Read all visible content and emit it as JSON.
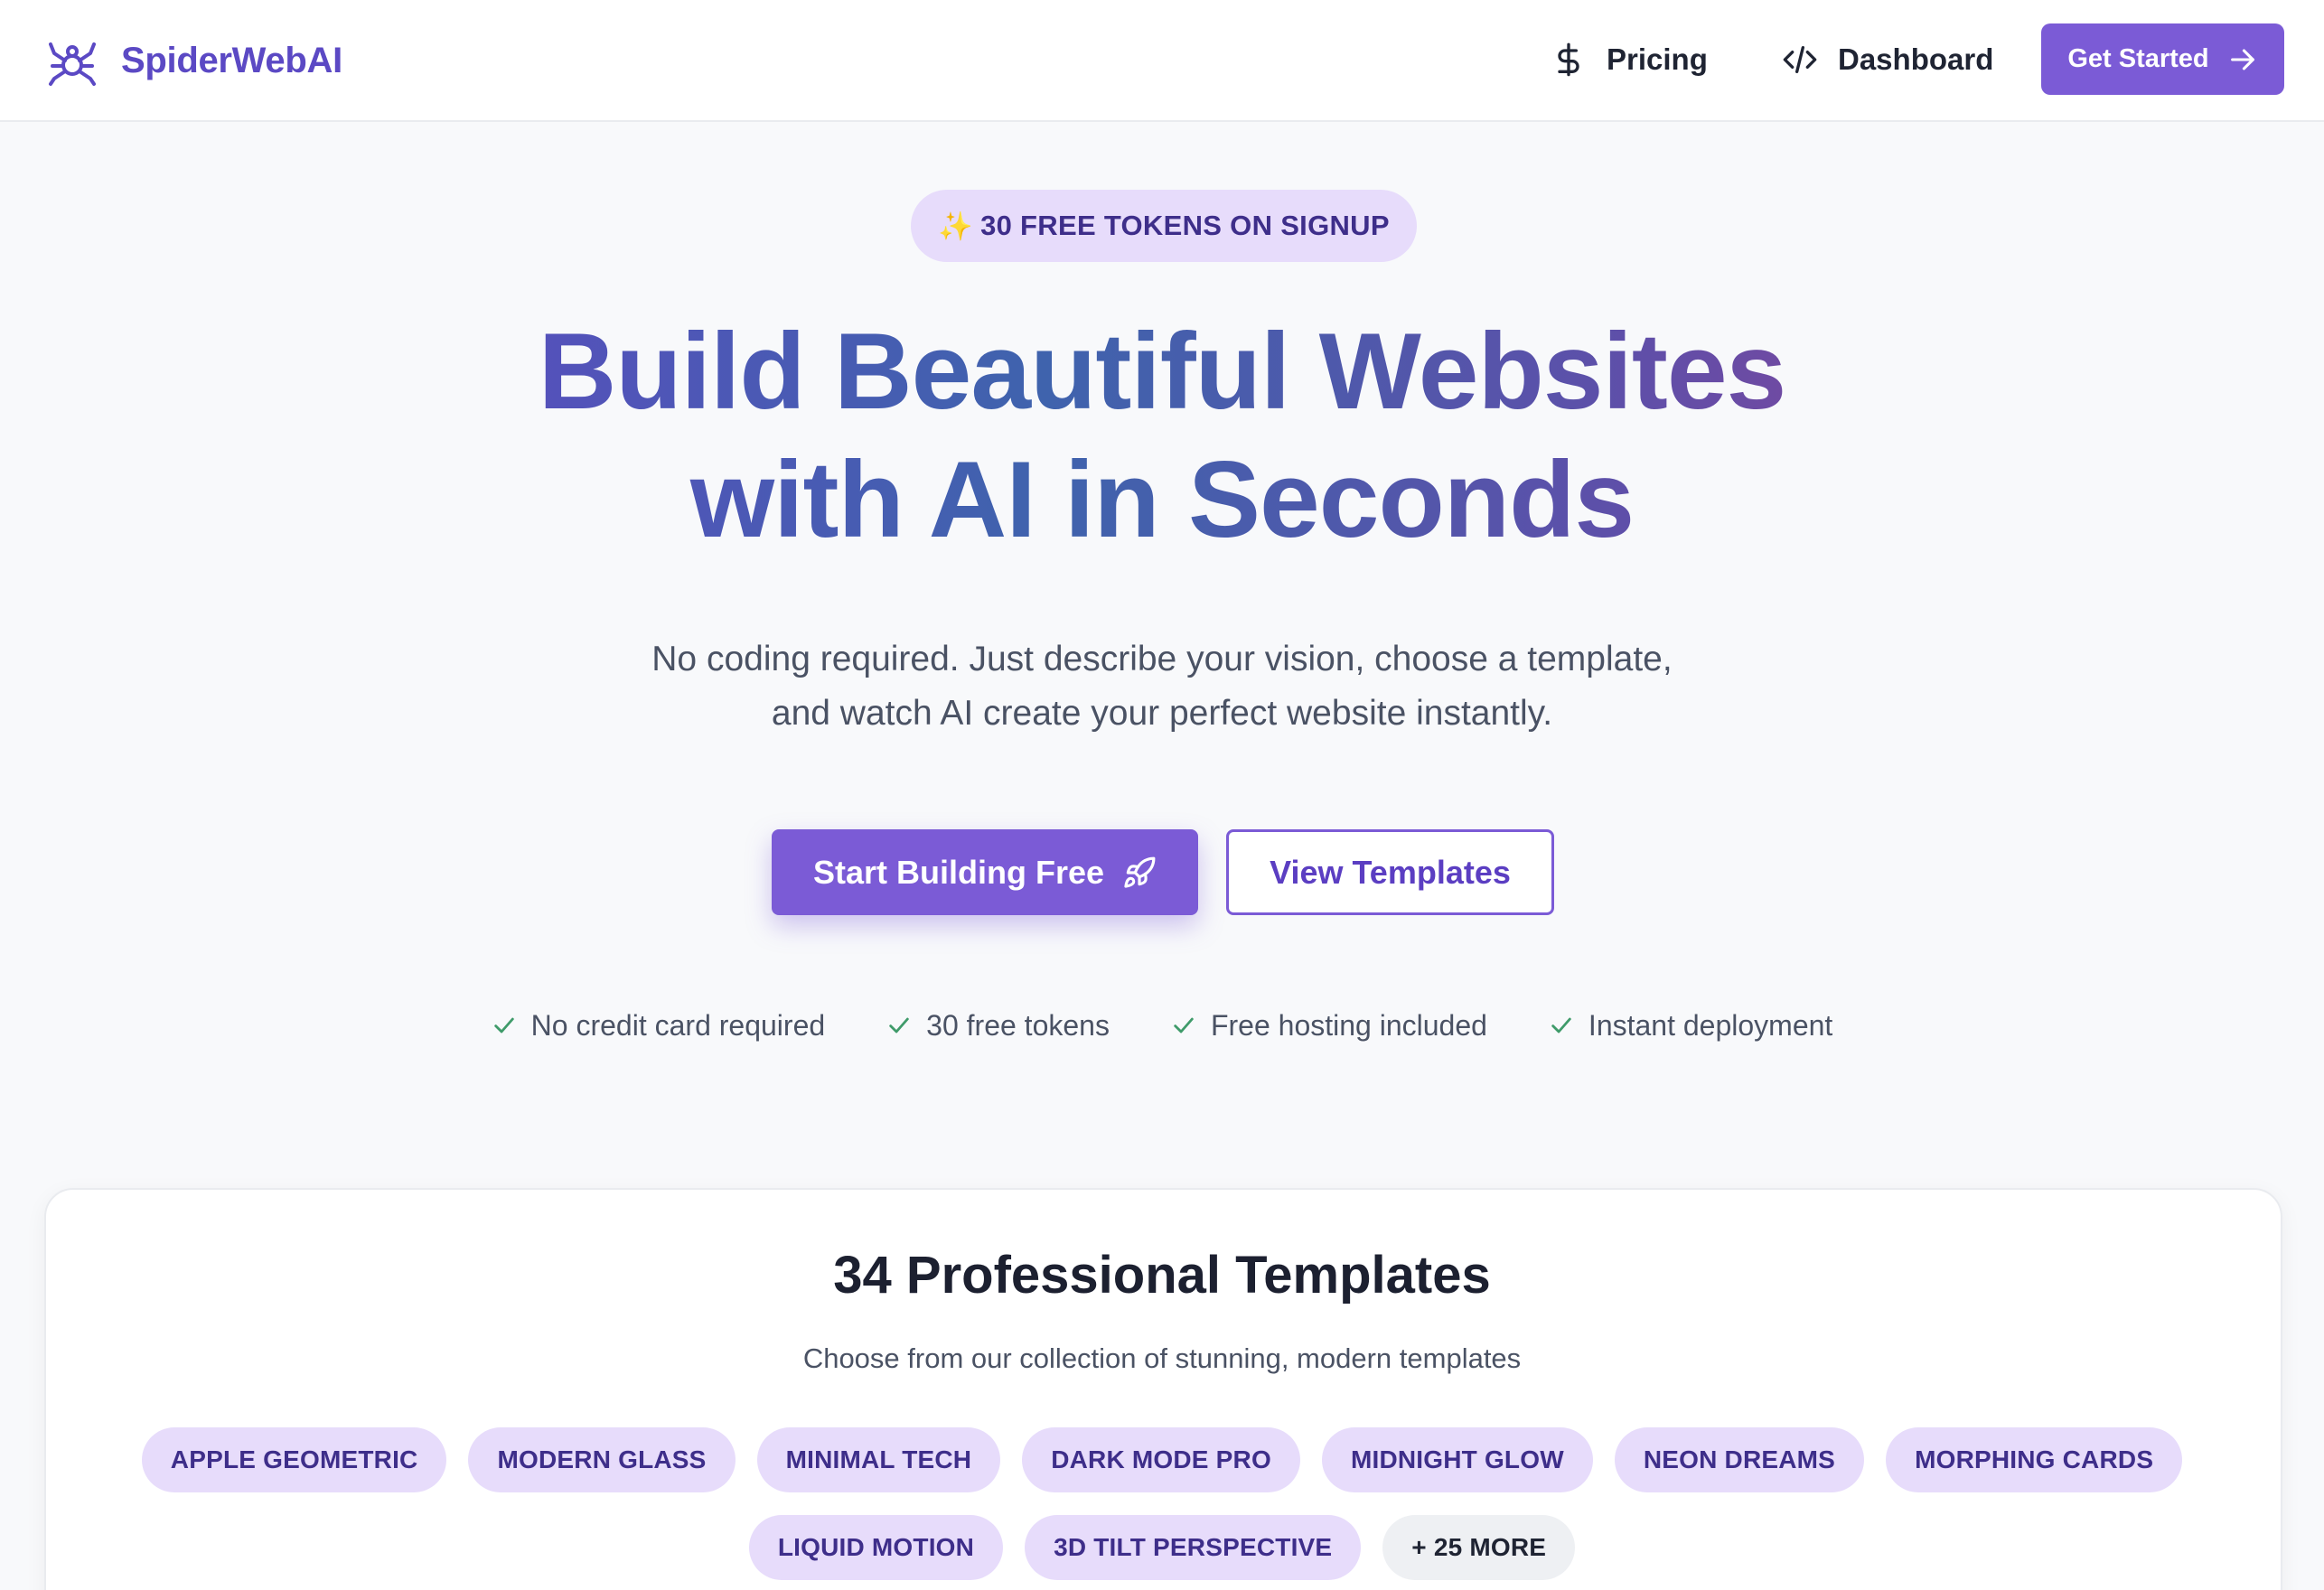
{
  "header": {
    "brand_name": "SpiderWebAI",
    "nav": [
      {
        "label": "Pricing",
        "icon": "dollar-icon"
      },
      {
        "label": "Dashboard",
        "icon": "code-icon"
      }
    ],
    "cta_label": "Get Started"
  },
  "hero": {
    "badge_icon": "✨",
    "badge": "30 FREE TOKENS ON SIGNUP",
    "title_line1": "Build Beautiful Websites",
    "title_line2": "with AI in Seconds",
    "subtitle_line1": "No coding required. Just describe your vision, choose a template,",
    "subtitle_line2": "and watch AI create your perfect website instantly.",
    "primary_button": "Start Building Free",
    "secondary_button": "View Templates",
    "features": [
      "No credit card required",
      "30 free tokens",
      "Free hosting included",
      "Instant deployment"
    ]
  },
  "templates": {
    "title": "34 Professional Templates",
    "subtitle": "Choose from our collection of stunning, modern templates",
    "tags_row1": [
      "APPLE GEOMETRIC",
      "MODERN GLASS",
      "MINIMAL TECH",
      "DARK MODE PRO",
      "MIDNIGHT GLOW",
      "NEON DREAMS",
      "MORPHING CARDS"
    ],
    "tags_row2": [
      "LIQUID MOTION",
      "3D TILT PERSPECTIVE"
    ],
    "more_label": "+ 25 MORE"
  },
  "colors": {
    "accent": "#7b5bd6",
    "brand_text": "#5b49c4",
    "tag_bg": "#e7dcfb",
    "tag_text": "#3e2e8a",
    "check": "#3f9b6a"
  }
}
